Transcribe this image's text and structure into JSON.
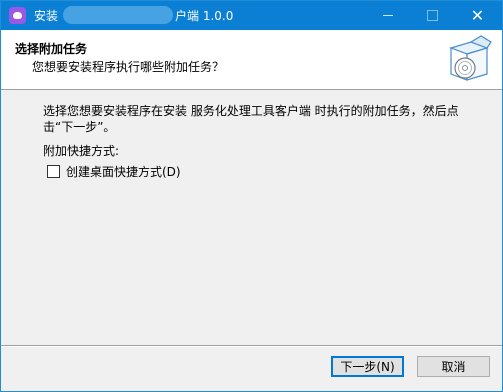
{
  "window": {
    "title_prefix": "安装",
    "title_suffix": "户端 1.0.0",
    "close_glyph": "✕"
  },
  "header": {
    "title": "选择附加任务",
    "subtitle": "您想要安装程序执行哪些附加任务？"
  },
  "content": {
    "description": "选择您想要安装程序在安装 服务化处理工具客户端 时执行的附加任务，然后点击“下一步”。",
    "section_label": "附加快捷方式:",
    "checkbox_label": "创建桌面快捷方式(D)",
    "checkbox_checked": false
  },
  "buttons": {
    "next": "下一步(N)",
    "cancel": "取消"
  },
  "icons": {
    "app": "app-icon",
    "header": "software-box-icon"
  }
}
